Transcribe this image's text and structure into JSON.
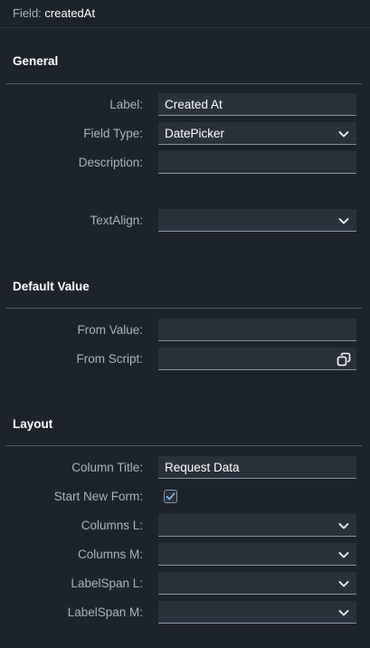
{
  "header": {
    "label": "Field:",
    "value": "createdAt"
  },
  "sections": {
    "general": {
      "title": "General",
      "label": {
        "label": "Label:",
        "value": "Created At"
      },
      "field_type": {
        "label": "Field Type:",
        "value": "DatePicker"
      },
      "description": {
        "label": "Description:",
        "value": ""
      },
      "text_align": {
        "label": "TextAlign:",
        "value": ""
      }
    },
    "default_value": {
      "title": "Default Value",
      "from_value": {
        "label": "From Value:",
        "value": ""
      },
      "from_script": {
        "label": "From Script:",
        "value": ""
      }
    },
    "layout": {
      "title": "Layout",
      "column_title": {
        "label": "Column Title:",
        "value": "Request Data"
      },
      "start_new_form": {
        "label": "Start New Form:",
        "checked": true
      },
      "columns_l": {
        "label": "Columns L:",
        "value": ""
      },
      "columns_m": {
        "label": "Columns M:",
        "value": ""
      },
      "labelspan_l": {
        "label": "LabelSpan L:",
        "value": ""
      },
      "labelspan_m": {
        "label": "LabelSpan M:",
        "value": ""
      }
    }
  },
  "icons": {
    "dropdown": "chevron-down-icon",
    "script": "open-dialog-icon",
    "check": "checkmark-icon"
  },
  "colors": {
    "background": "#1d232a",
    "field_bg": "#29313a",
    "accent": "#8cc4ff",
    "label": "#a9b4be"
  }
}
